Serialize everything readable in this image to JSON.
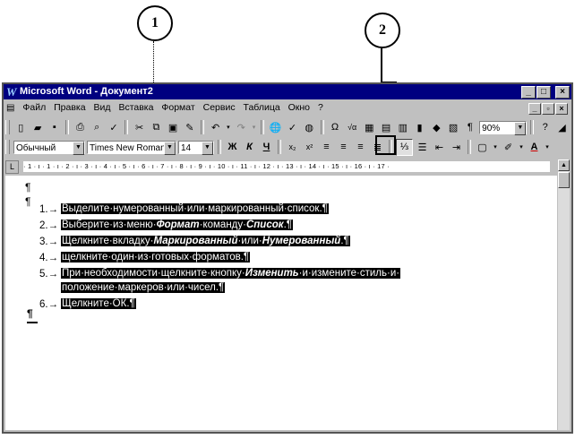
{
  "callouts": [
    "1",
    "2"
  ],
  "title": "Microsoft Word - Документ2",
  "window_buttons": [
    "_",
    "□",
    "×"
  ],
  "menu": [
    "Файл",
    "Правка",
    "Вид",
    "Вставка",
    "Формат",
    "Сервис",
    "Таблица",
    "Окно",
    "?"
  ],
  "standard_toolbar": {
    "zoom": "90%",
    "pilcrow": "¶",
    "omega": "Ω"
  },
  "formatting_toolbar": {
    "style": "Обычный",
    "font": "Times New Roman",
    "size": "14",
    "bold": "Ж",
    "italic": "К",
    "underline": "Ч"
  },
  "ruler": {
    "marks": "· 1 · ı · 1 · ı · 2 · ı · 3 · ı · 4 · ı · 5 · ı · 6 · ı · 7 · ı · 8 · ı · 9 · ı · 10 · ı · 11 · ı · 12 · ı · 13 · ı · 14 · ı · 15 · ı · 16 · ı · 17 ·"
  },
  "document": {
    "pilcrow": "¶",
    "items": [
      {
        "num": "1.→",
        "text": "Выделите·нумерованный·или·маркированный·список.¶"
      },
      {
        "num": "2.→",
        "pre": "Выберите·из·меню·",
        "b1": "Формат",
        "mid": "·команду·",
        "b2": "Список",
        "post": ".¶"
      },
      {
        "num": "3.→",
        "pre": "Щелкните·вкладку·",
        "b1": "Маркированный",
        "mid": "·или·",
        "b2": "Нумерованный",
        "post": ".¶"
      },
      {
        "num": "4.→",
        "text": "щелкните·один·из·готовых·форматов.¶"
      },
      {
        "num": "5.→",
        "pre": "При·необходимости·щелкните·кнопку·",
        "b1": "Изменить",
        "mid": "·и·измените·стиль·и·",
        "line2": "положение·маркеров·или·чисел.¶"
      },
      {
        "num": "6.→",
        "text": "Щелкните·ОК.¶"
      }
    ]
  }
}
